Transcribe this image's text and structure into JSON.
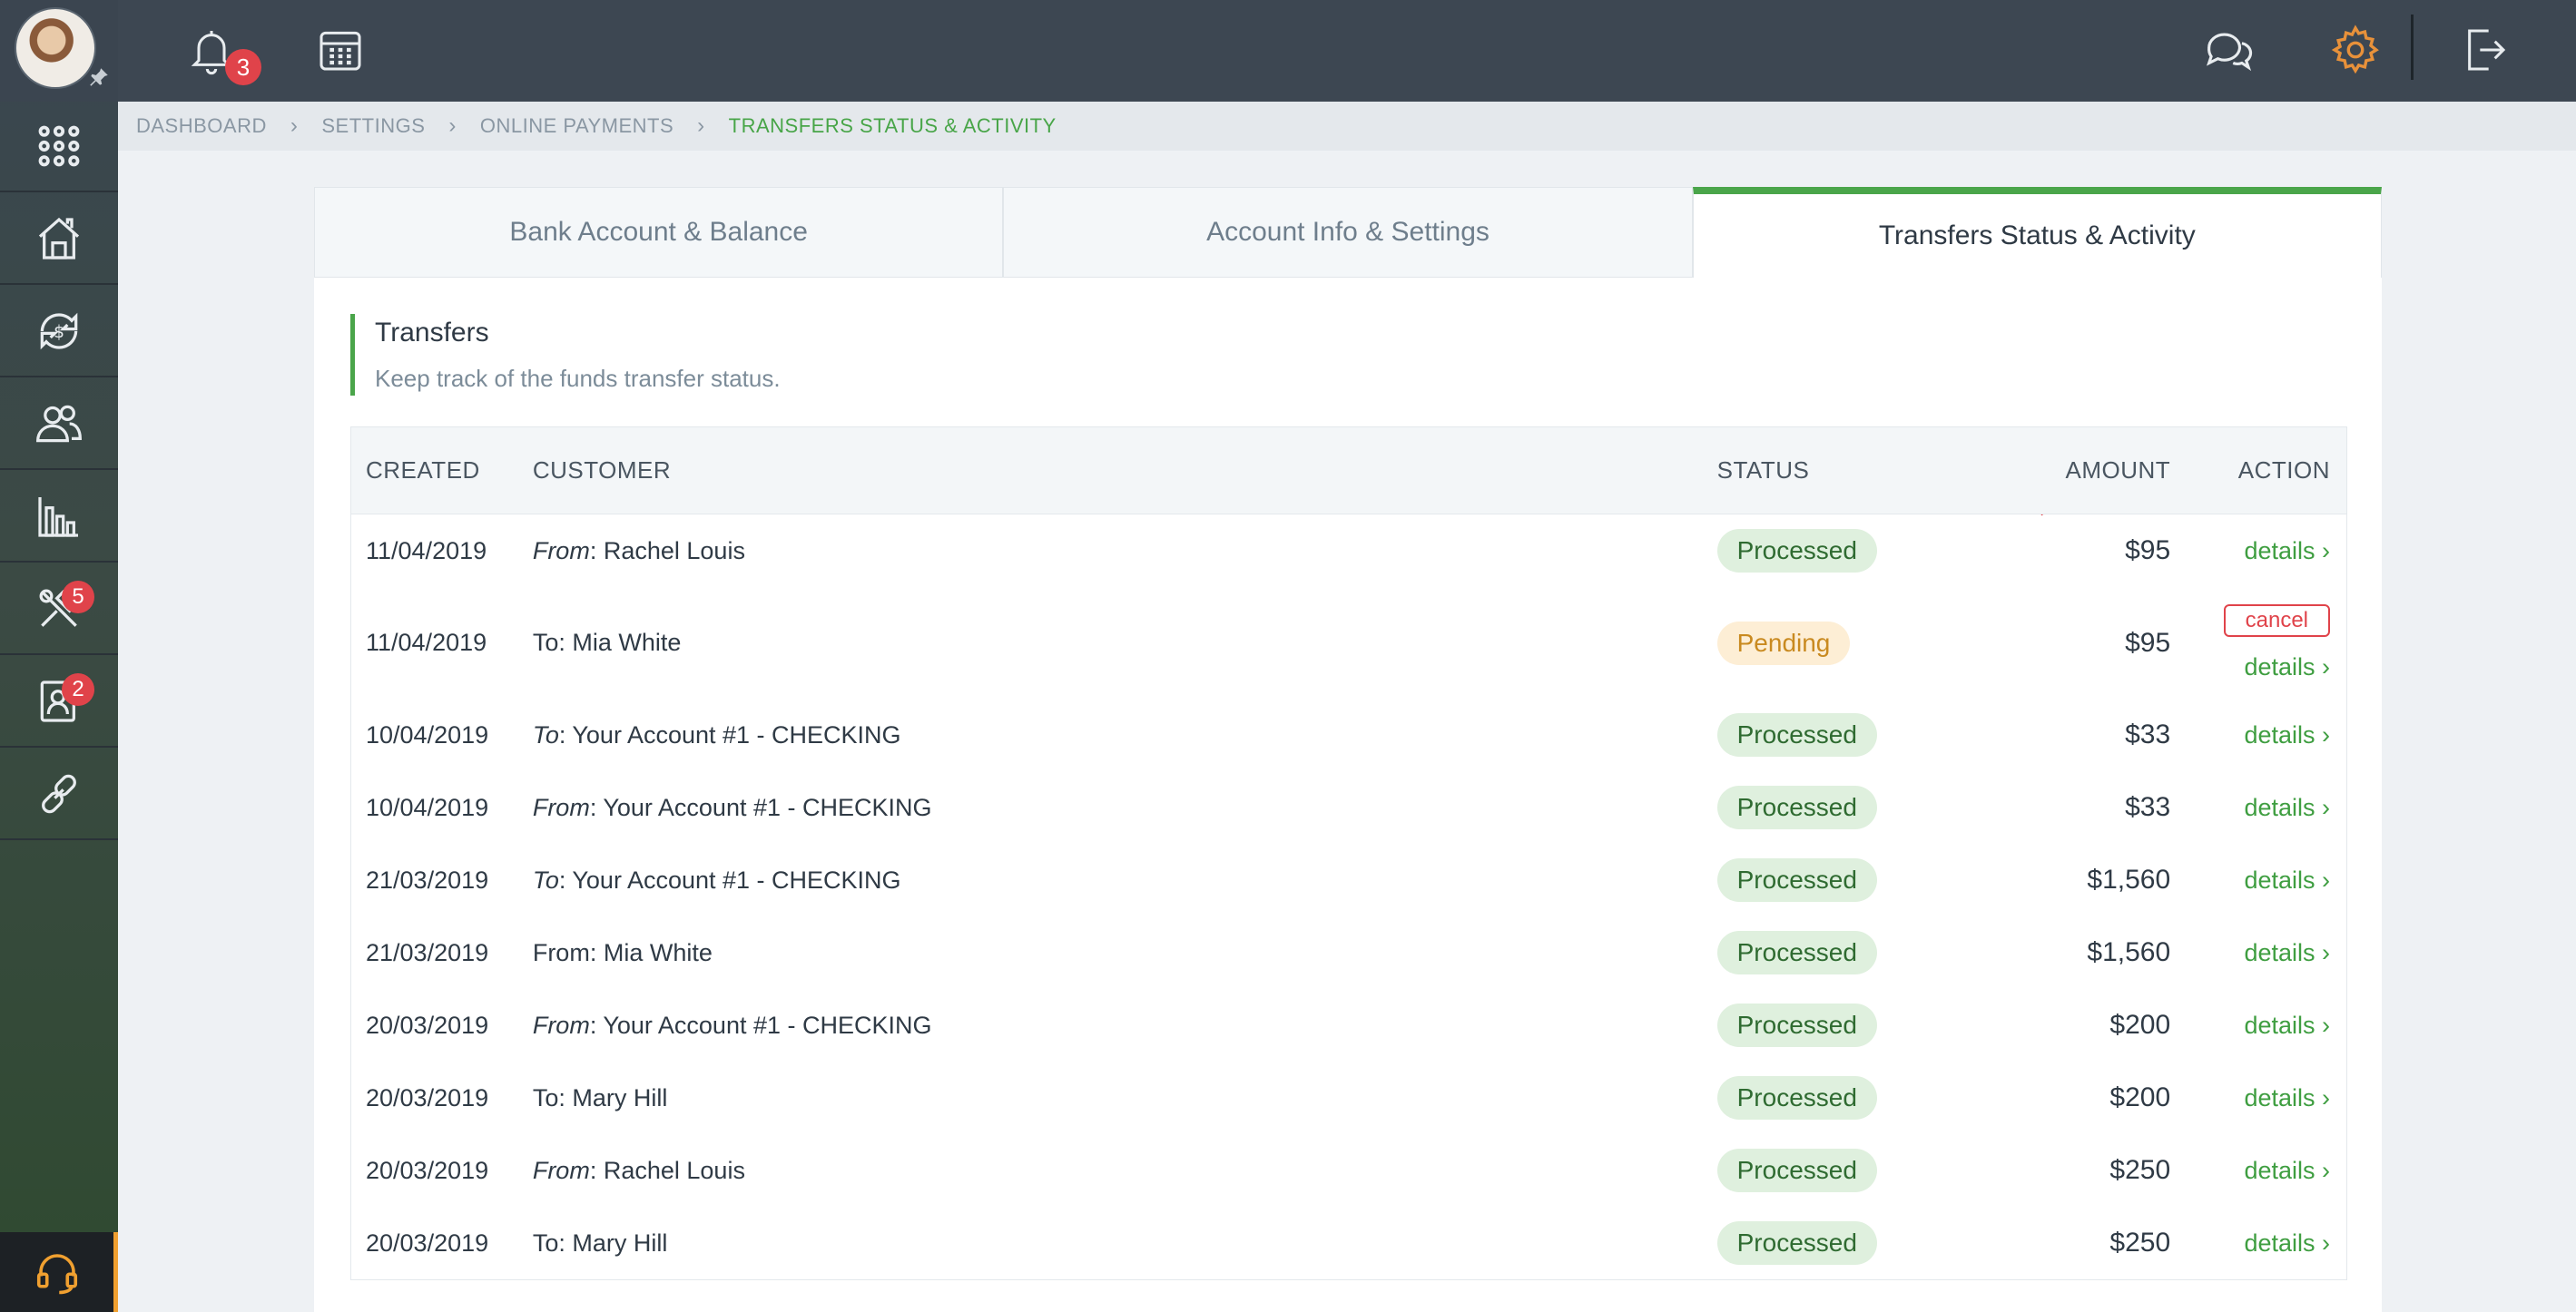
{
  "topbar": {
    "notification_count": "3"
  },
  "sidebar": {
    "tools_badge": "5",
    "contacts_badge": "2"
  },
  "breadcrumb": [
    "DASHBOARD",
    "SETTINGS",
    "ONLINE PAYMENTS",
    "TRANSFERS STATUS & ACTIVITY"
  ],
  "tabs": [
    "Bank Account & Balance",
    "Account Info & Settings",
    "Transfers Status & Activity"
  ],
  "section": {
    "title": "Transfers",
    "subtitle": "Keep track of the funds transfer status."
  },
  "table": {
    "headers": [
      "CREATED",
      "CUSTOMER",
      "STATUS",
      "AMOUNT",
      "ACTION"
    ],
    "rows": [
      {
        "created": "11/04/2019",
        "prefix": "From",
        "italic": true,
        "name": "Rachel Louis",
        "status": "Processed",
        "amount": "$95",
        "cancel": false
      },
      {
        "created": "11/04/2019",
        "prefix": "To",
        "italic": false,
        "name": "Mia White",
        "status": "Pending",
        "amount": "$95",
        "cancel": true
      },
      {
        "created": "10/04/2019",
        "prefix": "To",
        "italic": true,
        "name": "Your Account #1 - CHECKING",
        "status": "Processed",
        "amount": "$33",
        "cancel": false
      },
      {
        "created": "10/04/2019",
        "prefix": "From",
        "italic": true,
        "name": "Your Account #1 - CHECKING",
        "status": "Processed",
        "amount": "$33",
        "cancel": false
      },
      {
        "created": "21/03/2019",
        "prefix": "To",
        "italic": true,
        "name": "Your Account #1 - CHECKING",
        "status": "Processed",
        "amount": "$1,560",
        "cancel": false
      },
      {
        "created": "21/03/2019",
        "prefix": "From",
        "italic": false,
        "name": "Mia White",
        "status": "Processed",
        "amount": "$1,560",
        "cancel": false
      },
      {
        "created": "20/03/2019",
        "prefix": "From",
        "italic": true,
        "name": "Your Account #1 - CHECKING",
        "status": "Processed",
        "amount": "$200",
        "cancel": false
      },
      {
        "created": "20/03/2019",
        "prefix": "To",
        "italic": false,
        "name": "Mary Hill",
        "status": "Processed",
        "amount": "$200",
        "cancel": false
      },
      {
        "created": "20/03/2019",
        "prefix": "From",
        "italic": true,
        "name": "Rachel Louis",
        "status": "Processed",
        "amount": "$250",
        "cancel": false
      },
      {
        "created": "20/03/2019",
        "prefix": "To",
        "italic": false,
        "name": "Mary Hill",
        "status": "Processed",
        "amount": "$250",
        "cancel": false
      }
    ],
    "details_label": "details",
    "cancel_label": "cancel"
  },
  "colors": {
    "accent": "#4aa54a",
    "badge": "#e0434a",
    "settings": "#e8913a"
  }
}
